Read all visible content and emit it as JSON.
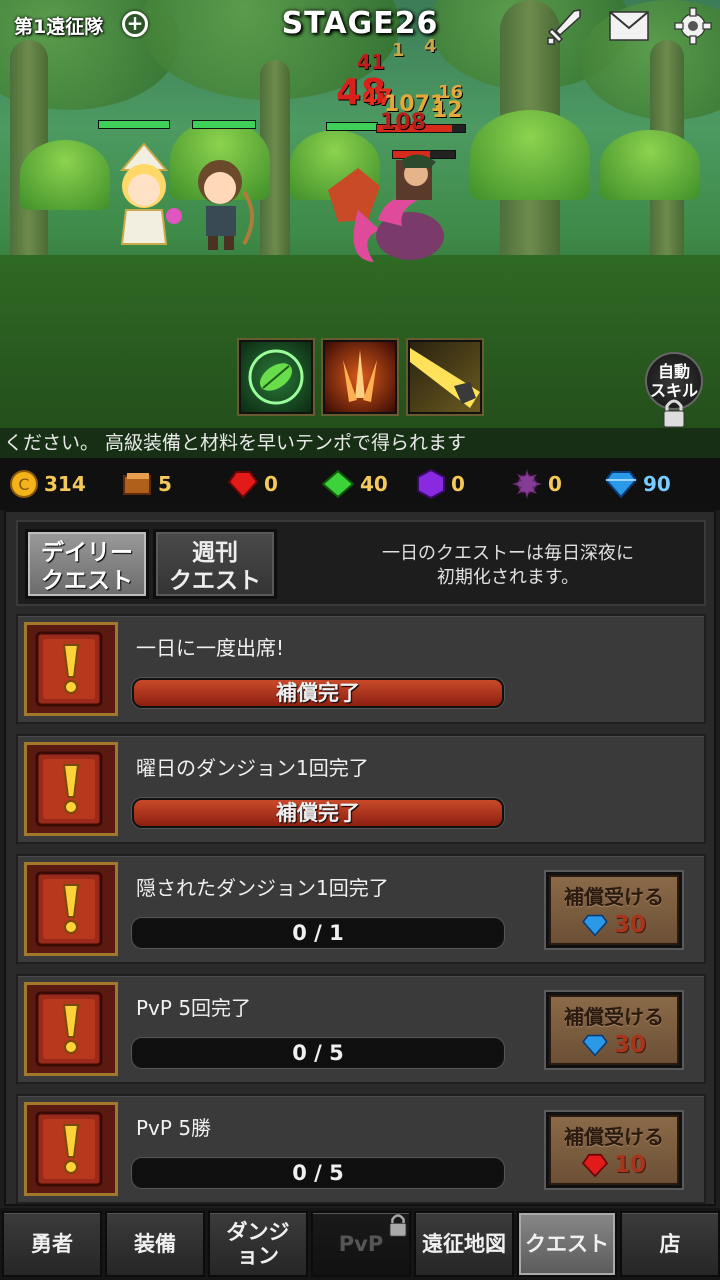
{
  "header": {
    "team_label": "第1遠征隊",
    "stage": "STAGE26",
    "icons": [
      "plus-icon",
      "sword-icon",
      "mail-icon",
      "gear-icon"
    ]
  },
  "battle": {
    "damage_numbers": [
      "41",
      "48",
      "47",
      "1071",
      "16",
      "12",
      "4",
      "1",
      "108"
    ],
    "skills": [
      "leaf-skill-icon",
      "triple-blade-skill-icon",
      "light-beam-skill-icon"
    ],
    "auto_skill_label": "自動\nスキル",
    "auto_skill_locked": true
  },
  "ticker": {
    "text": "ください。 高級装備と材料を早いテンポで得られます"
  },
  "currency": {
    "gold": "314",
    "book": "5",
    "red_gem": "0",
    "green_gem": "40",
    "purple_gem": "0",
    "dark_orb": "0",
    "diamond": "90"
  },
  "quests_panel": {
    "tabs": [
      {
        "label": "デイリー\nクエスト",
        "active": true
      },
      {
        "label": "週刊\nクエスト",
        "active": false
      }
    ],
    "reset_note": "一日のクエストーは毎日深夜に\n初期化されます。",
    "quests": [
      {
        "title": "一日に一度出席!",
        "progress": "補償完了",
        "done": true
      },
      {
        "title": "曜日のダンジョン1回完了",
        "progress": "補償完了",
        "done": true
      },
      {
        "title": "隠されたダンジョン1回完了",
        "progress": "0 / 1",
        "done": false,
        "claim_label": "補償受ける",
        "reward_icon": "diamond-icon",
        "reward": "30"
      },
      {
        "title": "PvP 5回完了",
        "progress": "0 / 5",
        "done": false,
        "claim_label": "補償受ける",
        "reward_icon": "diamond-icon",
        "reward": "30"
      },
      {
        "title": "PvP 5勝",
        "progress": "0 / 5",
        "done": false,
        "claim_label": "補償受ける",
        "reward_icon": "red-gem-icon",
        "reward": "10"
      }
    ]
  },
  "bottom_nav": [
    {
      "label": "勇者"
    },
    {
      "label": "装備"
    },
    {
      "label": "ダンジ\nョン"
    },
    {
      "label": "PvP",
      "locked": true
    },
    {
      "label": "遠征地図"
    },
    {
      "label": "クエスト",
      "active": true
    },
    {
      "label": "店"
    }
  ],
  "colors": {
    "accent_gold": "#f4c95a",
    "complete_bar": "#b8341c",
    "active_tab": "#8a8a8a"
  }
}
